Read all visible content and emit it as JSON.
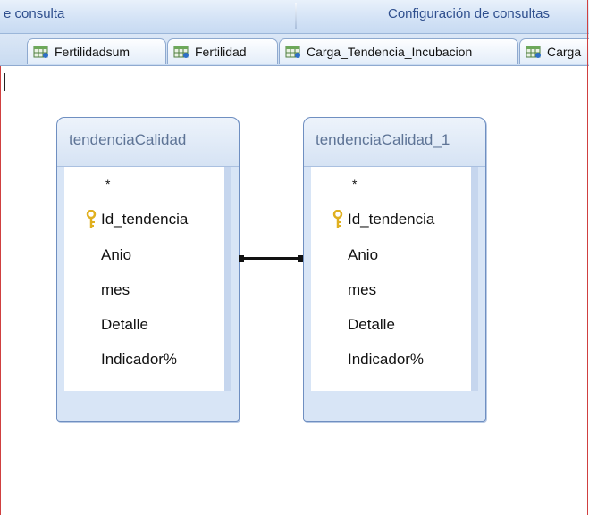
{
  "ribbon": {
    "left_group": "e consulta",
    "right_group": "Configuración de consultas"
  },
  "tabs": [
    {
      "label": "Fertilidadsum"
    },
    {
      "label": "Fertilidad"
    },
    {
      "label": "Carga_Tendencia_Incubacion"
    },
    {
      "label": "Carga"
    }
  ],
  "tables": [
    {
      "title": "tendenciaCalidad",
      "fields": [
        "*",
        "Id_tendencia",
        "Anio",
        "mes",
        "Detalle",
        "Indicador%"
      ]
    },
    {
      "title": "tendenciaCalidad_1",
      "fields": [
        "*",
        "Id_tendencia",
        "Anio",
        "mes",
        "Detalle",
        "Indicador%"
      ]
    }
  ],
  "colors": {
    "ribbon_text": "#2f4f8e",
    "table_title_text": "#5e7496",
    "key_icon": "#e0b020",
    "frame_red": "#d04040"
  },
  "icons": {
    "tab": "query-datasheet-icon",
    "primary_key": "key-icon"
  }
}
